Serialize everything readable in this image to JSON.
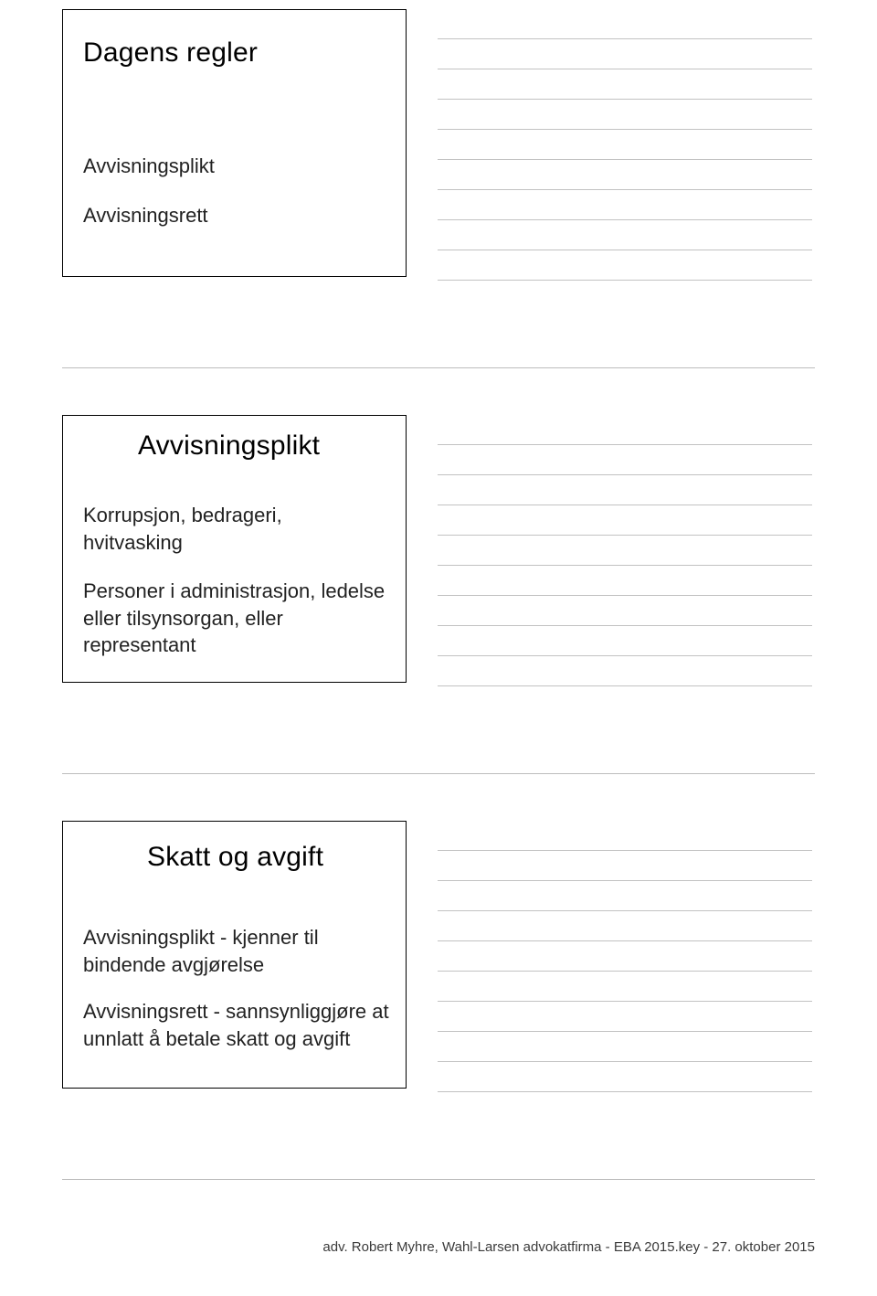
{
  "slide1": {
    "title": "Dagens regler",
    "p1": "Avvisningsplikt",
    "p2": "Avvisningsrett"
  },
  "slide2": {
    "title": "Avvisningsplikt",
    "p1": "Korrupsjon, bedrageri, hvitvasking",
    "p2": "Personer i administrasjon, ledelse eller tilsynsorgan, eller representant"
  },
  "slide3": {
    "title": "Skatt og avgift",
    "p1": "Avvisningsplikt - kjenner til bindende avgjørelse",
    "p2": "Avvisningsrett - sannsynliggjøre at unnlatt å betale skatt og avgift"
  },
  "footer": "adv. Robert Myhre, Wahl-Larsen advokatfirma - EBA 2015.key - 27. oktober 2015"
}
